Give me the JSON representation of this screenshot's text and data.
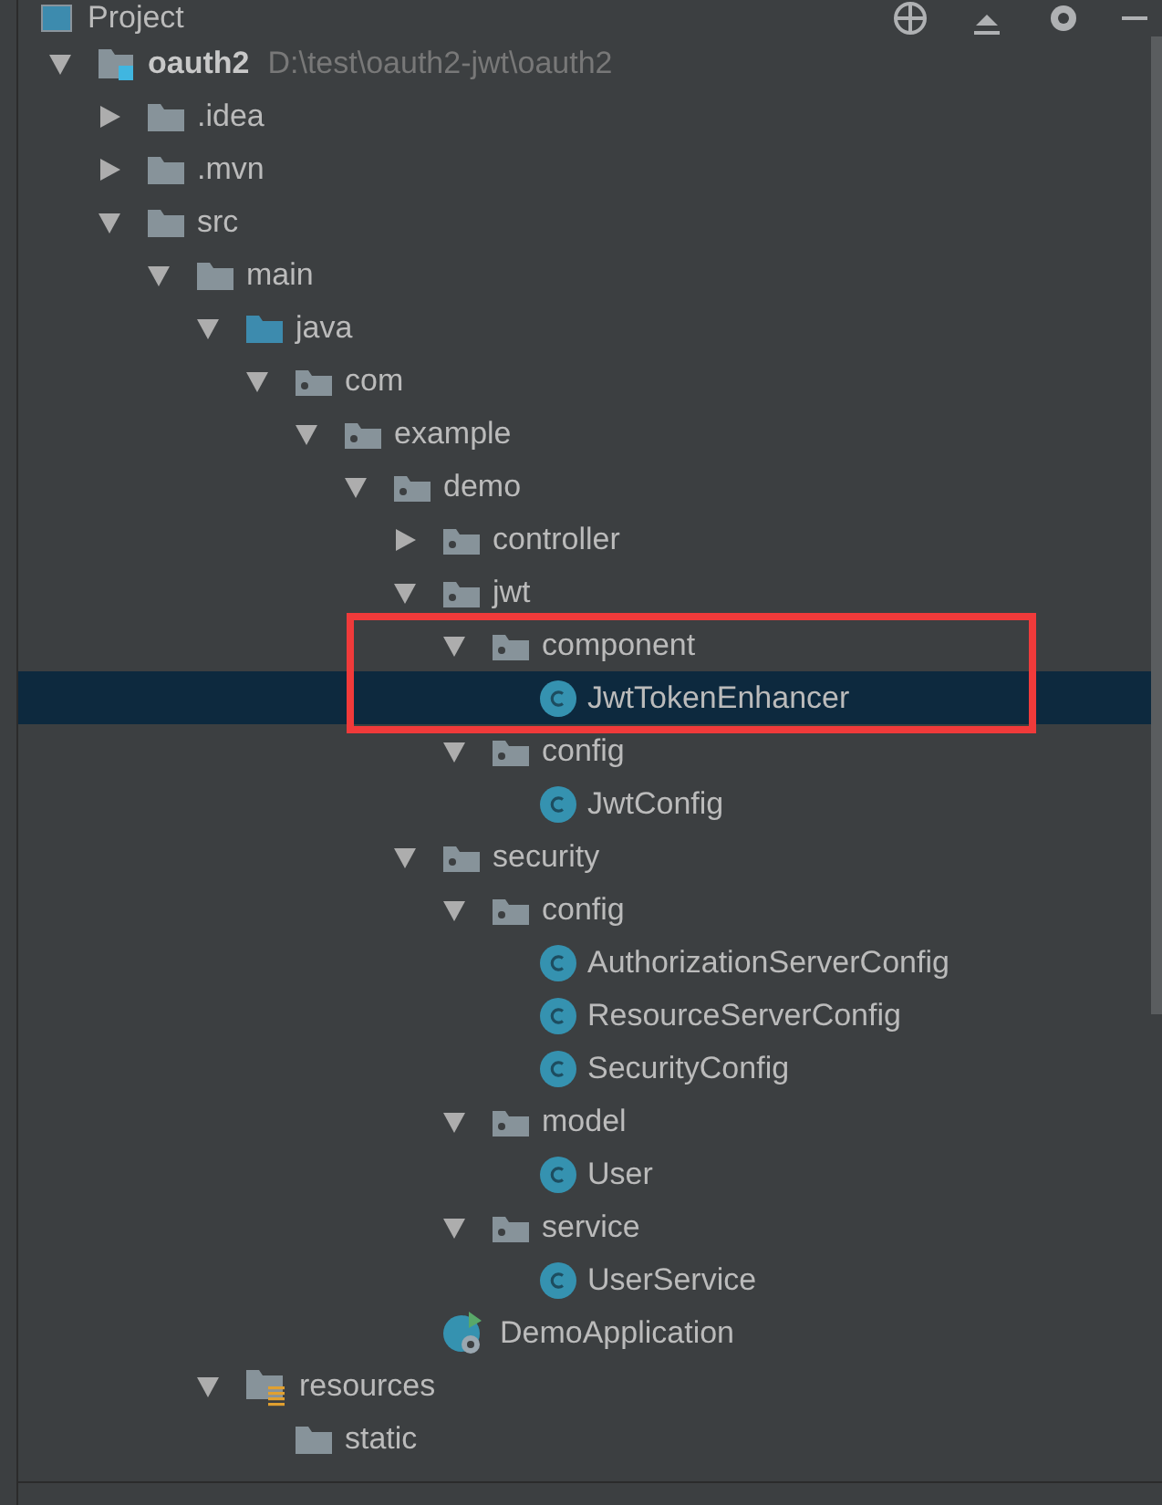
{
  "panel": {
    "title": "Project"
  },
  "tree": [
    {
      "kind": "module",
      "name": "oauth2",
      "path": "D:\\test\\oauth2-jwt\\oauth2",
      "expanded": true,
      "selected": false,
      "children": [
        {
          "kind": "folder",
          "name": ".idea",
          "expanded": false,
          "selected": false
        },
        {
          "kind": "folder",
          "name": ".mvn",
          "expanded": false,
          "selected": false
        },
        {
          "kind": "folder",
          "name": "src",
          "expanded": true,
          "selected": false,
          "children": [
            {
              "kind": "folder",
              "name": "main",
              "expanded": true,
              "selected": false,
              "children": [
                {
                  "kind": "source-folder",
                  "name": "java",
                  "expanded": true,
                  "selected": false,
                  "children": [
                    {
                      "kind": "package",
                      "name": "com",
                      "expanded": true,
                      "selected": false,
                      "children": [
                        {
                          "kind": "package",
                          "name": "example",
                          "expanded": true,
                          "selected": false,
                          "children": [
                            {
                              "kind": "package",
                              "name": "demo",
                              "expanded": true,
                              "selected": false,
                              "children": [
                                {
                                  "kind": "package",
                                  "name": "controller",
                                  "expanded": false,
                                  "selected": false
                                },
                                {
                                  "kind": "package",
                                  "name": "jwt",
                                  "expanded": true,
                                  "selected": false,
                                  "children": [
                                    {
                                      "kind": "package",
                                      "name": "component",
                                      "expanded": true,
                                      "selected": false,
                                      "highlighted": true,
                                      "children": [
                                        {
                                          "kind": "class",
                                          "name": "JwtTokenEnhancer",
                                          "selected": true
                                        }
                                      ]
                                    },
                                    {
                                      "kind": "package",
                                      "name": "config",
                                      "expanded": true,
                                      "selected": false,
                                      "children": [
                                        {
                                          "kind": "class",
                                          "name": "JwtConfig",
                                          "selected": false
                                        }
                                      ]
                                    }
                                  ]
                                },
                                {
                                  "kind": "package",
                                  "name": "security",
                                  "expanded": true,
                                  "selected": false,
                                  "children": [
                                    {
                                      "kind": "package",
                                      "name": "config",
                                      "expanded": true,
                                      "selected": false,
                                      "children": [
                                        {
                                          "kind": "class",
                                          "name": "AuthorizationServerConfig",
                                          "selected": false
                                        },
                                        {
                                          "kind": "class",
                                          "name": "ResourceServerConfig",
                                          "selected": false
                                        },
                                        {
                                          "kind": "class",
                                          "name": "SecurityConfig",
                                          "selected": false
                                        }
                                      ]
                                    },
                                    {
                                      "kind": "package",
                                      "name": "model",
                                      "expanded": true,
                                      "selected": false,
                                      "children": [
                                        {
                                          "kind": "class",
                                          "name": "User",
                                          "selected": false
                                        }
                                      ]
                                    },
                                    {
                                      "kind": "package",
                                      "name": "service",
                                      "expanded": true,
                                      "selected": false,
                                      "children": [
                                        {
                                          "kind": "class",
                                          "name": "UserService",
                                          "selected": false
                                        }
                                      ]
                                    }
                                  ]
                                },
                                {
                                  "kind": "spring-app",
                                  "name": "DemoApplication",
                                  "selected": false
                                }
                              ]
                            }
                          ]
                        }
                      ]
                    }
                  ]
                },
                {
                  "kind": "resources",
                  "name": "resources",
                  "expanded": true,
                  "selected": false,
                  "children": [
                    {
                      "kind": "folder",
                      "name": "static",
                      "selected": false
                    }
                  ]
                }
              ]
            }
          ]
        }
      ]
    }
  ]
}
